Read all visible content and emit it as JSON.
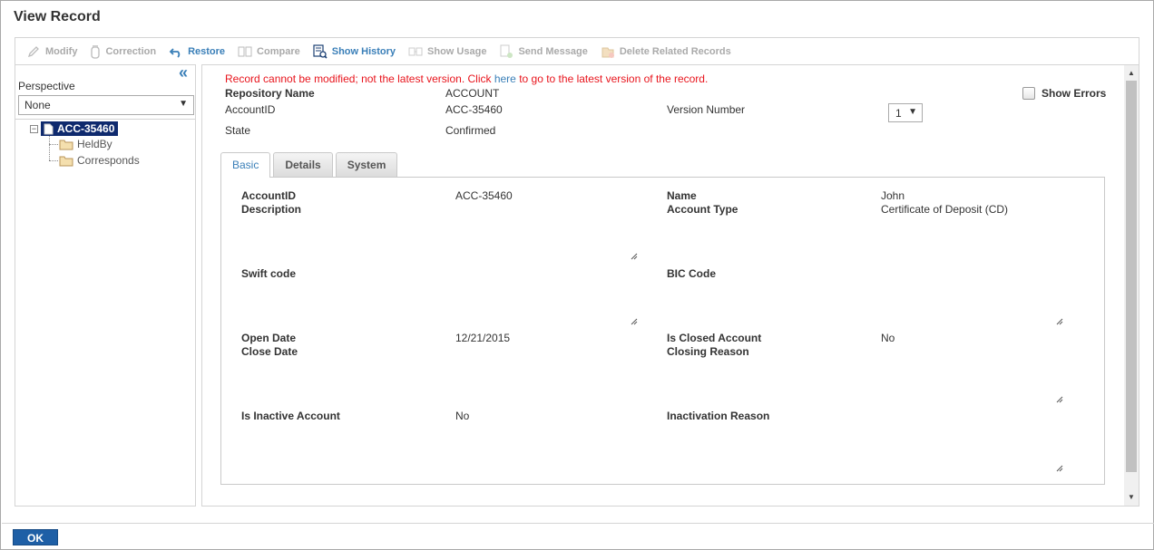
{
  "window": {
    "title": "View Record"
  },
  "toolbar": {
    "items": [
      {
        "label": "Modify",
        "icon": "pencil-icon",
        "enabled": false
      },
      {
        "label": "Correction",
        "icon": "jar-icon",
        "enabled": false
      },
      {
        "label": "Restore",
        "icon": "undo-icon",
        "enabled": true
      },
      {
        "label": "Compare",
        "icon": "compare-icon",
        "enabled": false
      },
      {
        "label": "Show History",
        "icon": "history-icon",
        "enabled": true
      },
      {
        "label": "Show Usage",
        "icon": "usage-icon",
        "enabled": false
      },
      {
        "label": "Send Message",
        "icon": "send-message-icon",
        "enabled": false
      },
      {
        "label": "Delete Related Records",
        "icon": "delete-related-icon",
        "enabled": false
      }
    ]
  },
  "left": {
    "perspective_label": "Perspective",
    "perspective_value": "None",
    "tree": {
      "root": "ACC-35460",
      "children": [
        "HeldBy",
        "Corresponds"
      ]
    }
  },
  "main": {
    "warning_before": "Record cannot be modified; not the latest version. Click ",
    "warning_link": "here",
    "warning_after": " to go to the latest version of the record.",
    "repository_label": "Repository Name",
    "repository_value": "ACCOUNT",
    "accountid_label": "AccountID",
    "accountid_value": "ACC-35460",
    "state_label": "State",
    "state_value": "Confirmed",
    "version_label": "Version Number",
    "version_value": "1",
    "show_errors_label": "Show Errors",
    "tabs": [
      {
        "label": "Basic",
        "active": true
      },
      {
        "label": "Details",
        "active": false
      },
      {
        "label": "System",
        "active": false
      }
    ]
  },
  "form": {
    "accountid_label": "AccountID",
    "accountid_value": "ACC-35460",
    "name_label": "Name",
    "name_value": "John",
    "description_label": "Description",
    "description_value": "",
    "account_type_label": "Account Type",
    "account_type_value": "Certificate of Deposit (CD)",
    "swift_label": "Swift code",
    "swift_value": "",
    "bic_label": "BIC Code",
    "bic_value": "",
    "open_date_label": "Open Date",
    "open_date_value": "12/21/2015",
    "is_closed_label": "Is Closed Account",
    "is_closed_value": "No",
    "close_date_label": "Close Date",
    "close_date_value": "",
    "closing_reason_label": "Closing Reason",
    "closing_reason_value": "",
    "inactive_label": "Is Inactive Account",
    "inactive_value": "No",
    "inactivation_reason_label": "Inactivation Reason",
    "inactivation_reason_value": ""
  },
  "footer": {
    "ok_label": "OK"
  },
  "colors": {
    "accent": "#3a7fb8",
    "warning": "#e8141c",
    "selection": "#0f2a6e",
    "ok_button": "#1e5fa6"
  }
}
